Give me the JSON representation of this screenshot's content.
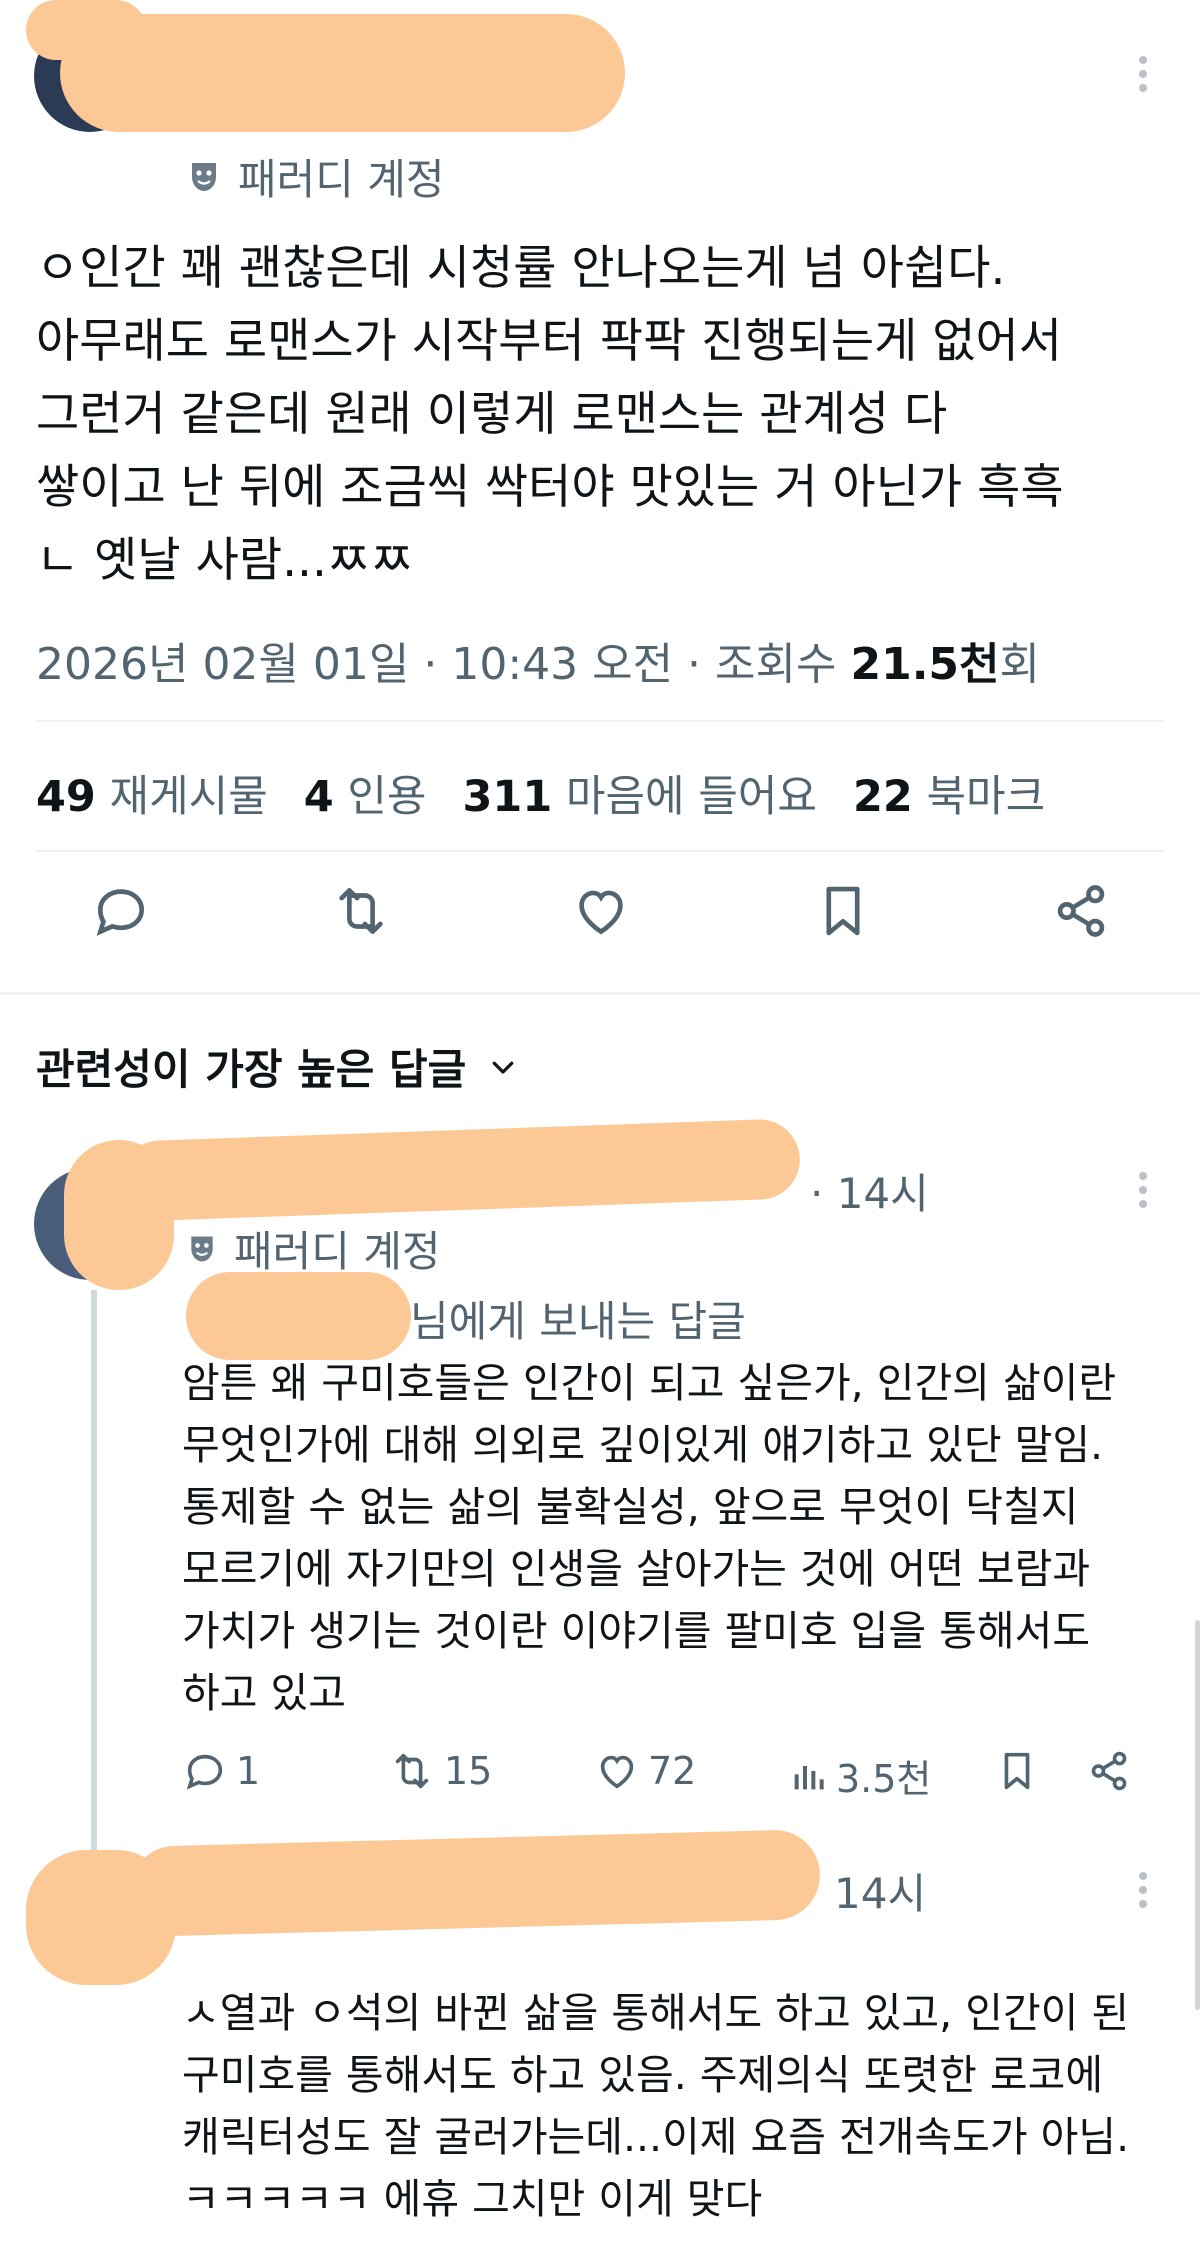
{
  "tweet": {
    "parody_label": "패러디 계정",
    "text": "ㅇ인간 꽤 괜찮은데 시청률 안나오는게 넘 아쉽다.\n아무래도 로맨스가 시작부터 팍팍 진행되는게 없어서\n그런거 같은데 원래 이렇게 로맨스는 관계성 다\n쌓이고 난 뒤에 조금씩 싹터야 맛있는 거 아닌가 흑흑\nㄴ 옛날 사람...ㅉㅉ",
    "meta_prefix": "2026년 02월 01일 · 10:43 오전 · 조회수 ",
    "views_value": "21.5천",
    "views_suffix": "회",
    "stats": [
      {
        "value": "49",
        "label": "재게시물"
      },
      {
        "value": "4",
        "label": "인용"
      },
      {
        "value": "311",
        "label": "마음에 들어요"
      },
      {
        "value": "22",
        "label": "북마크"
      }
    ],
    "action_icons": [
      "reply-icon",
      "retweet-icon",
      "like-icon",
      "bookmark-icon",
      "share-icon"
    ]
  },
  "replies_section": {
    "title": "관련성이 가장 높은 답글"
  },
  "reply1": {
    "time": "· 14시",
    "parody_label": "패러디 계정",
    "reply_to": "님에게 보내는 답글",
    "text": "암튼 왜 구미호들은 인간이 되고 싶은가, 인간의 삶이란\n무엇인가에 대해 의외로 깊이있게 얘기하고 있단 말임.\n통제할 수 없는 삶의 불확실성, 앞으로 무엇이 닥칠지\n모르기에 자기만의 인생을 살아가는 것에 어떤 보람과\n가치가 생기는 것이란 이야기를 팔미호 입을 통해서도\n하고 있고",
    "counts": {
      "replies": "1",
      "reposts": "15",
      "likes": "72",
      "views": "3.5천"
    }
  },
  "reply2": {
    "time": "14시",
    "text": "ㅅ열과 ㅇ석의 바뀐 삶을 통해서도 하고 있고, 인간이 된\n구미호를 통해서도 하고 있음.  주제의식 또렷한 로코에\n캐릭터성도 잘 굴러가는데...이제 요즘 전개속도가 아님.\nㅋㅋㅋㅋㅋ 에휴 그치만 이게 맞다"
  },
  "colors": {
    "text": "#0f1419",
    "muted": "#536471",
    "divider": "#eff3f4",
    "redaction": "#fcc895"
  }
}
